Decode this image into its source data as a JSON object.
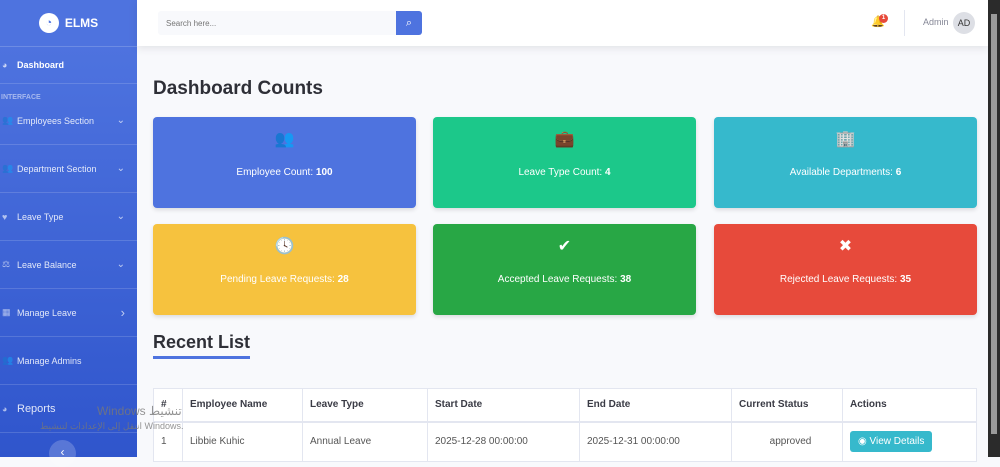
{
  "brand": {
    "name": "ELMS"
  },
  "sidebar": {
    "dashboard": "Dashboard",
    "heading": "INTERFACE",
    "items": [
      {
        "label": "Employees Section",
        "icon": "users-icon",
        "chev": "⌄"
      },
      {
        "label": "Department Section",
        "icon": "users-icon",
        "chev": "⌄"
      },
      {
        "label": "Leave Type",
        "icon": "heart-icon",
        "chev": "⌄"
      },
      {
        "label": "Leave Balance",
        "icon": "balance-icon",
        "chev": "⌄"
      },
      {
        "label": "Manage Leave",
        "icon": "table-icon",
        "chev": "›"
      },
      {
        "label": "Manage Admins",
        "icon": "users-icon",
        "chev": ""
      },
      {
        "label": "Reports",
        "icon": "pie-chart-icon",
        "chev": ""
      }
    ]
  },
  "topbar": {
    "search_placeholder": "Search here...",
    "notif_count": "1",
    "user": "Admin",
    "avatar": "AD"
  },
  "main": {
    "title": "Dashboard Counts",
    "recent_title": "Recent List",
    "cards": [
      {
        "label": "Employee Count: ",
        "value": "100",
        "color": "#4e73df",
        "icon": "👥"
      },
      {
        "label": "Leave Type Count: ",
        "value": "4",
        "color": "#1cc88a",
        "icon": "💼"
      },
      {
        "label": "Available Departments: ",
        "value": "6",
        "color": "#36b9cc",
        "icon": "🏢"
      },
      {
        "label": "Pending Leave Requests: ",
        "value": "28",
        "color": "#f6c23e",
        "icon": "🕓"
      },
      {
        "label": "Accepted Leave Requests: ",
        "value": "38",
        "color": "#28a745",
        "icon": "✔"
      },
      {
        "label": "Rejected Leave Requests: ",
        "value": "35",
        "color": "#e74a3b",
        "icon": "✖"
      }
    ],
    "table": {
      "headers": [
        "#",
        "Employee Name",
        "Leave Type",
        "Start Date",
        "End Date",
        "Current Status",
        "Actions"
      ],
      "rows": [
        {
          "num": "1",
          "name": "Libbie Kuhic",
          "type": "Annual Leave",
          "start": "2025-12-28 00:00:00",
          "end": "2025-12-31 00:00:00",
          "status": "approved",
          "action": "View Details"
        }
      ]
    }
  },
  "watermark": {
    "line1": "Windows تنشيط",
    "line2": "انتقل إلى الإعدادات لتنشيط Windows."
  }
}
